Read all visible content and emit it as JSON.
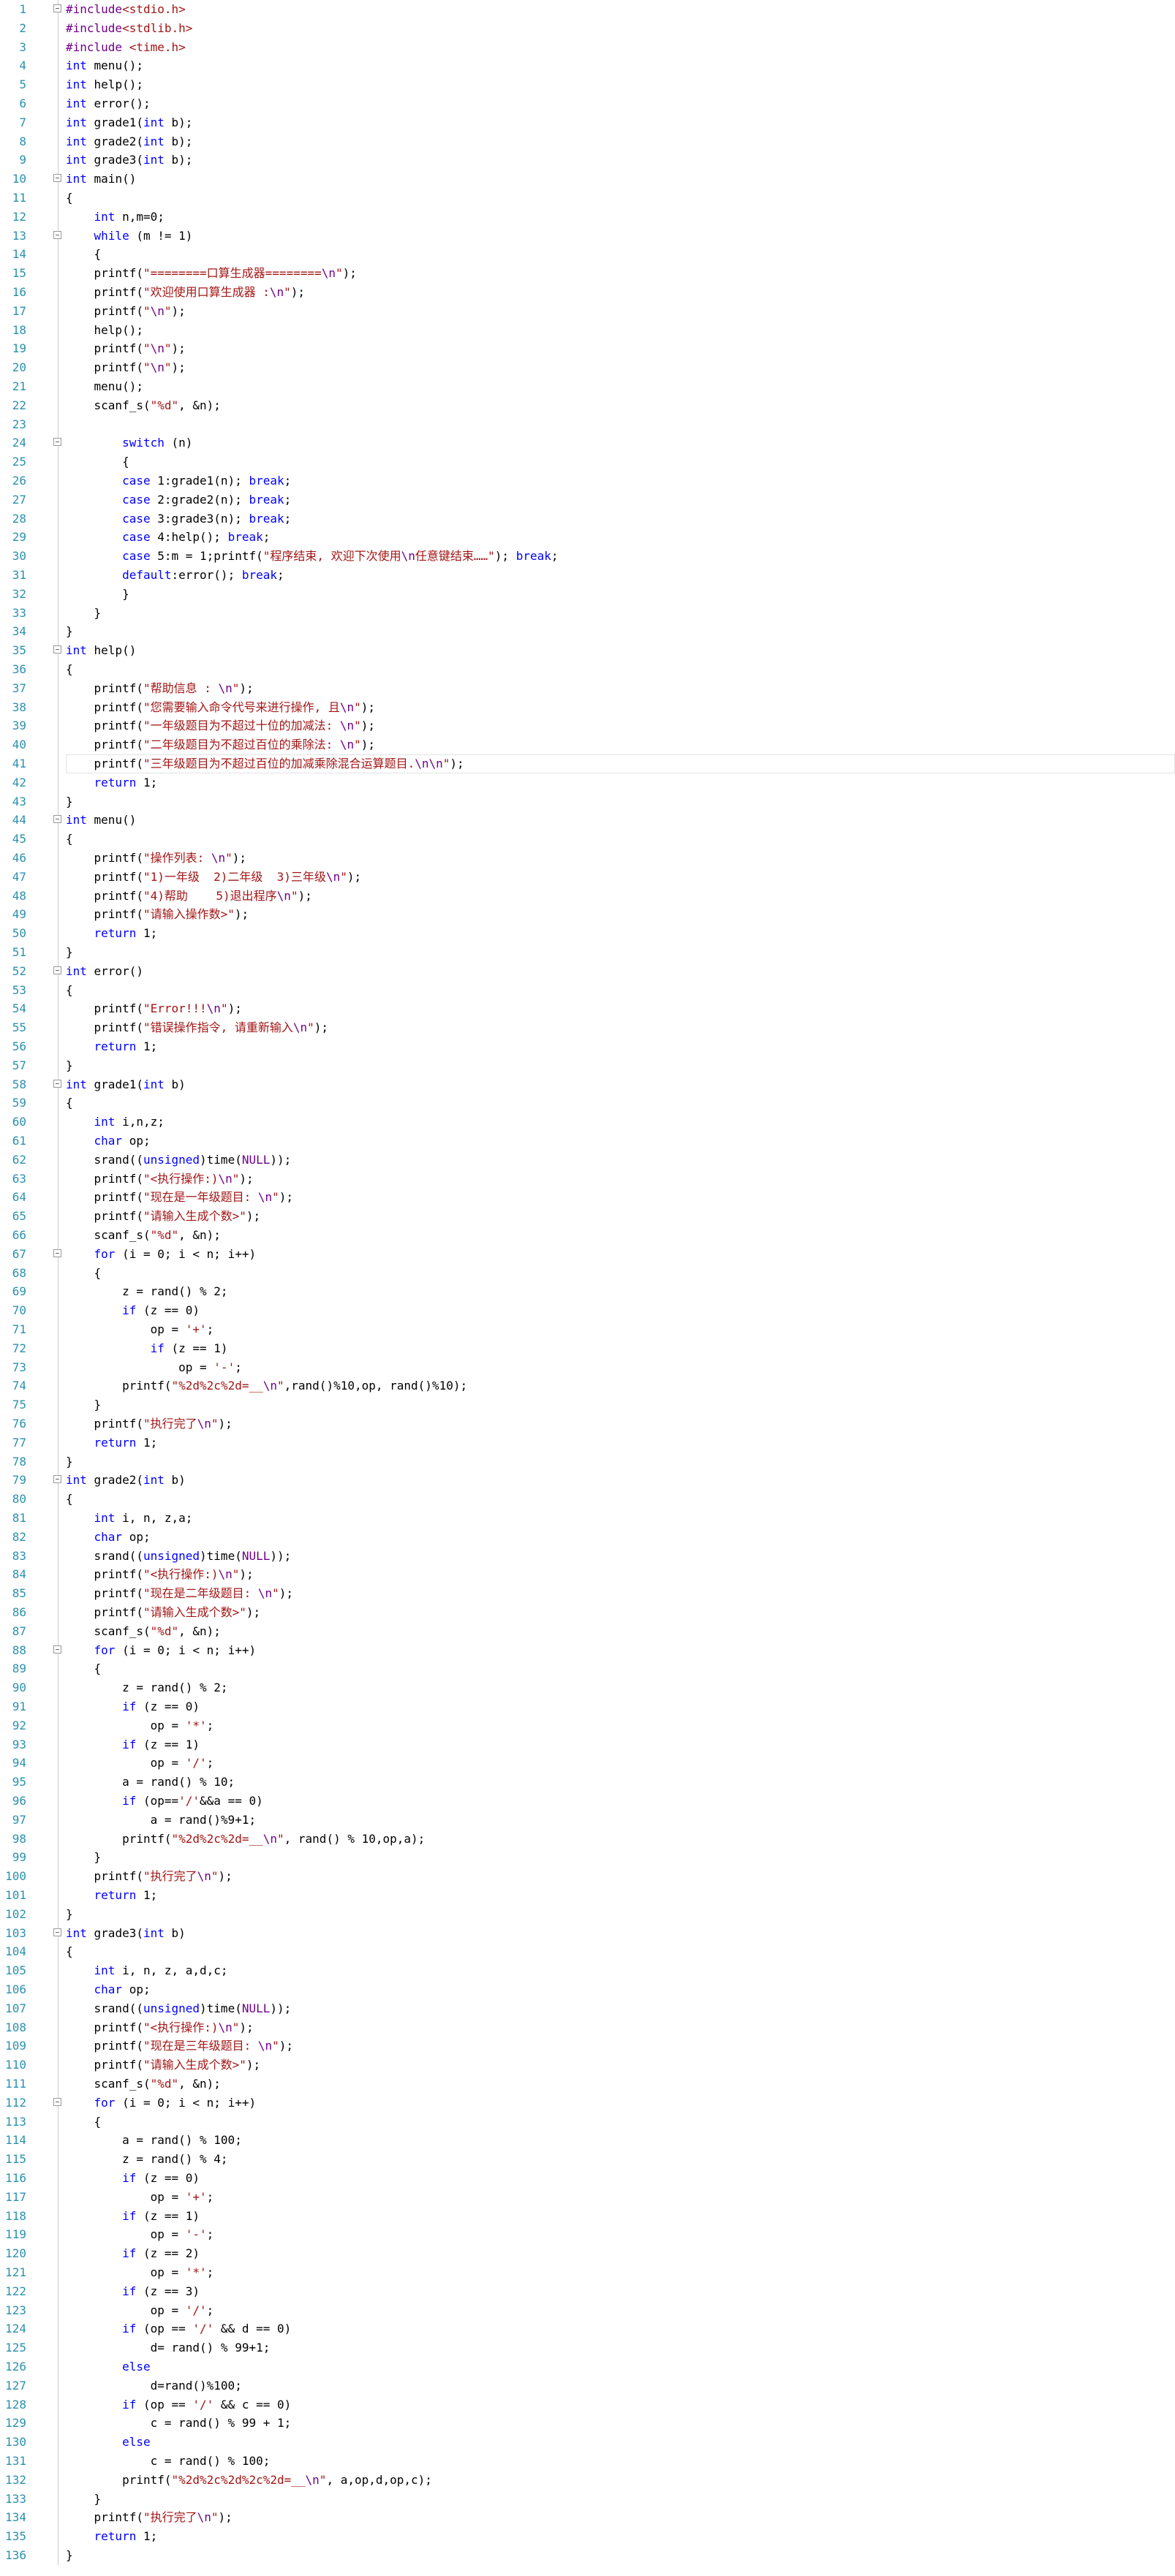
{
  "editor": {
    "lines": [
      "#include<stdio.h>",
      "#include<stdlib.h>",
      "#include <time.h>",
      "int menu();",
      "int help();",
      "int error();",
      "int grade1(int b);",
      "int grade2(int b);",
      "int grade3(int b);",
      "int main()",
      "{",
      "    int n,m=0;",
      "    while (m != 1)",
      "    {",
      "    printf(\"========口算生成器========\\n\");",
      "    printf(\"欢迎使用口算生成器 :\\n\");",
      "    printf(\"\\n\");",
      "    help();",
      "    printf(\"\\n\");",
      "    printf(\"\\n\");",
      "    menu();",
      "    scanf_s(\"%d\", &n);",
      "",
      "        switch (n)",
      "        {",
      "        case 1:grade1(n); break;",
      "        case 2:grade2(n); break;",
      "        case 3:grade3(n); break;",
      "        case 4:help(); break;",
      "        case 5:m = 1;printf(\"程序结束, 欢迎下次使用\\n任意键结束……\"); break;",
      "        default:error(); break;",
      "        }",
      "    }",
      "}",
      "int help()",
      "{",
      "    printf(\"帮助信息 : \\n\");",
      "    printf(\"您需要输入命令代号来进行操作, 且\\n\");",
      "    printf(\"一年级题目为不超过十位的加减法: \\n\");",
      "    printf(\"二年级题目为不超过百位的乘除法: \\n\");",
      "    printf(\"三年级题目为不超过百位的加减乘除混合运算题目.\\n\\n\");",
      "    return 1;",
      "}",
      "int menu()",
      "{",
      "    printf(\"操作列表: \\n\");",
      "    printf(\"1)一年级  2)二年级  3)三年级\\n\");",
      "    printf(\"4)帮助    5)退出程序\\n\");",
      "    printf(\"请输入操作数>\");",
      "    return 1;",
      "}",
      "int error()",
      "{",
      "    printf(\"Error!!!\\n\");",
      "    printf(\"错误操作指令, 请重新输入\\n\");",
      "    return 1;",
      "}",
      "int grade1(int b)",
      "{",
      "    int i,n,z;",
      "    char op;",
      "    srand((unsigned)time(NULL));",
      "    printf(\"<执行操作:)\\n\");",
      "    printf(\"现在是一年级题目: \\n\");",
      "    printf(\"请输入生成个数>\");",
      "    scanf_s(\"%d\", &n);",
      "    for (i = 0; i < n; i++)",
      "    {",
      "        z = rand() % 2;",
      "        if (z == 0)",
      "            op = '+';",
      "            if (z == 1)",
      "                op = '-';",
      "        printf(\"%2d%2c%2d=__\\n\",rand()%10,op, rand()%10);",
      "    }",
      "    printf(\"执行完了\\n\");",
      "    return 1;",
      "}",
      "int grade2(int b)",
      "{",
      "    int i, n, z,a;",
      "    char op;",
      "    srand((unsigned)time(NULL));",
      "    printf(\"<执行操作:)\\n\");",
      "    printf(\"现在是二年级题目: \\n\");",
      "    printf(\"请输入生成个数>\");",
      "    scanf_s(\"%d\", &n);",
      "    for (i = 0; i < n; i++)",
      "    {",
      "        z = rand() % 2;",
      "        if (z == 0)",
      "            op = '*';",
      "        if (z == 1)",
      "            op = '/';",
      "        a = rand() % 10;",
      "        if (op=='/'&&a == 0)",
      "            a = rand()%9+1;",
      "        printf(\"%2d%2c%2d=__\\n\", rand() % 10,op,a);",
      "    }",
      "    printf(\"执行完了\\n\");",
      "    return 1;",
      "}",
      "int grade3(int b)",
      "{",
      "    int i, n, z, a,d,c;",
      "    char op;",
      "    srand((unsigned)time(NULL));",
      "    printf(\"<执行操作:)\\n\");",
      "    printf(\"现在是三年级题目: \\n\");",
      "    printf(\"请输入生成个数>\");",
      "    scanf_s(\"%d\", &n);",
      "    for (i = 0; i < n; i++)",
      "    {",
      "        a = rand() % 100;",
      "        z = rand() % 4;",
      "        if (z == 0)",
      "            op = '+';",
      "        if (z == 1)",
      "            op = '-';",
      "        if (z == 2)",
      "            op = '*';",
      "        if (z == 3)",
      "            op = '/';",
      "        if (op == '/' && d == 0)",
      "            d= rand() % 99+1;",
      "        else",
      "            d=rand()%100;",
      "        if (op == '/' && c == 0)",
      "            c = rand() % 99 + 1;",
      "        else",
      "            c = rand() % 100;",
      "        printf(\"%2d%2c%2d%2c%2d=__\\n\", a,op,d,op,c);",
      "    }",
      "    printf(\"执行完了\\n\");",
      "    return 1;",
      "}"
    ],
    "fold_lines": [
      1,
      10,
      13,
      24,
      35,
      44,
      52,
      58,
      67,
      79,
      88,
      103,
      112
    ],
    "current_line": 41
  }
}
